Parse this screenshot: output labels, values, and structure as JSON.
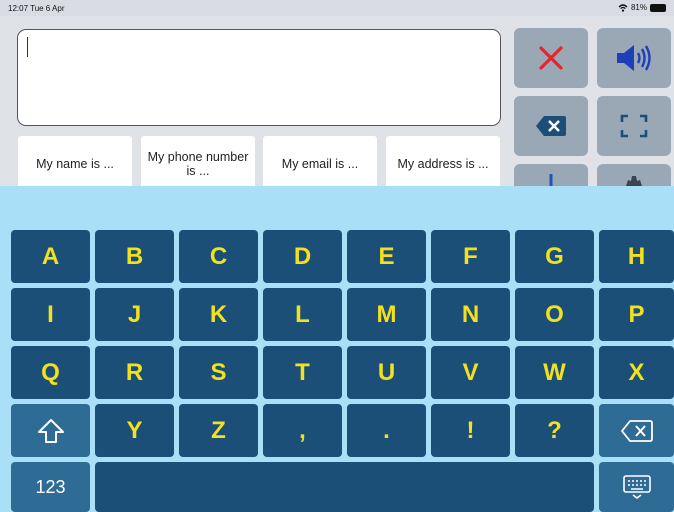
{
  "status": {
    "time": "12:07  Tue 6 Apr",
    "battery": "81%"
  },
  "text_input": {
    "value": ""
  },
  "phrases": [
    "My name is ...",
    "My phone number is ...",
    "My email is ...",
    "My address is ..."
  ],
  "actions": {
    "clear_icon": "close-x-icon",
    "speak_icon": "speaker-icon",
    "delete_icon": "backspace-icon",
    "fullscreen_icon": "fullscreen-icon",
    "share_icon": "share-icon",
    "settings_icon": "gear-icon"
  },
  "keyboard": {
    "rows": [
      [
        "A",
        "B",
        "C",
        "D",
        "E",
        "F",
        "G",
        "H"
      ],
      [
        "I",
        "J",
        "K",
        "L",
        "M",
        "N",
        "O",
        "P"
      ],
      [
        "Q",
        "R",
        "S",
        "T",
        "U",
        "V",
        "W",
        "X"
      ],
      [
        "Y",
        "Z",
        ",",
        ".",
        "!",
        "?"
      ]
    ],
    "numbers_label": "123",
    "shift_icon": "shift-icon",
    "backspace_icon": "backspace-icon",
    "hide_keyboard_icon": "keyboard-hide-icon"
  },
  "colors": {
    "key": "#1c4f78",
    "key_text": "#f2e11c",
    "keyboard_bg": "#a9e0f8",
    "action_bg": "#9aa8b6",
    "clear_red": "#e8242b",
    "speaker_blue": "#1d3fb8"
  }
}
